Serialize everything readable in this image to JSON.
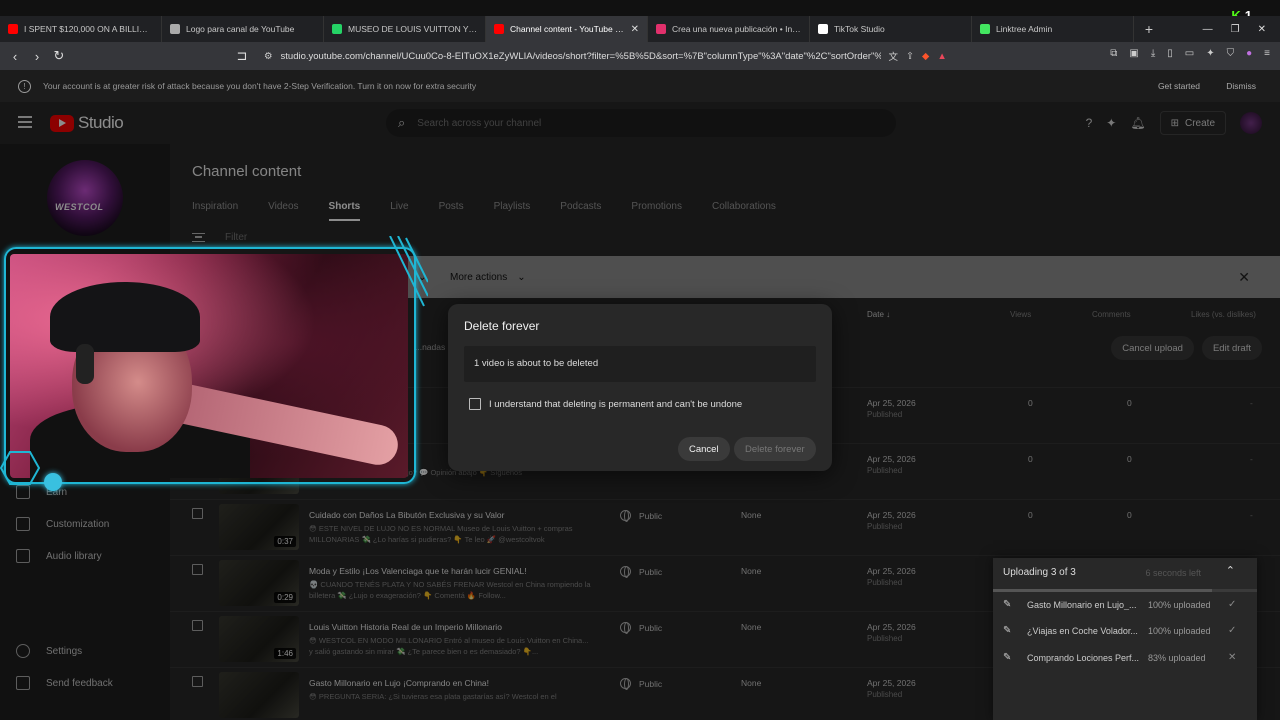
{
  "browser": {
    "tabs": [
      {
        "title": "I SPENT $120,000 ON A BILLIONAIRE",
        "color": "#ff0000"
      },
      {
        "title": "Logo para canal de YouTube",
        "color": "#aaaaaa"
      },
      {
        "title": "MUSEO DE LOUIS VUITTON Y COMP",
        "color": "#25d366"
      },
      {
        "title": "Channel content - YouTube Studio",
        "color": "#ff0000"
      },
      {
        "title": "Crea una nueva publicación • Instagr",
        "color": "#e1306c"
      },
      {
        "title": "TikTok Studio",
        "color": "#ffffff"
      },
      {
        "title": "Linktree Admin",
        "color": "#43e660"
      }
    ],
    "url": "studio.youtube.com/channel/UCuu0Co-8-EITuOX1eZyWLIA/videos/short?filter=%5B%5D&sort=%7B\"columnType\"%3A\"date\"%2C\"sortOrder\"%3...",
    "kick_count": "1"
  },
  "banner": {
    "text": "Your account is at greater risk of attack because you don't have 2-Step Verification. Turn it on now for extra security",
    "get_started": "Get started",
    "dismiss": "Dismiss"
  },
  "header": {
    "logo": "Studio",
    "search_placeholder": "Search across your channel",
    "create": "Create"
  },
  "sidebar": {
    "channel_name": "WESTCOL",
    "items": {
      "earn": "Earn",
      "customization": "Customization",
      "audio_library": "Audio library",
      "settings": "Settings",
      "send_feedback": "Send feedback"
    }
  },
  "main": {
    "title": "Channel content",
    "tabs": [
      "Inspiration",
      "Videos",
      "Shorts",
      "Live",
      "Posts",
      "Playlists",
      "Podcasts",
      "Promotions",
      "Collaborations"
    ],
    "filter_placeholder": "Filter",
    "more_actions": "More actions",
    "columns": {
      "date": "Date ↓",
      "views": "Views",
      "comments": "Comments",
      "likes": "Likes (vs. dislikes)"
    },
    "draft": {
      "text": "...nadas Ex...",
      "cancel_upload": "Cancel upload",
      "edit_draft": "Edit draft"
    },
    "rows": [
      {
        "title": "...ras Exc...",
        "desc": "...TODO W... ...go s acio...",
        "duration": "",
        "visibility": "",
        "restrictions": "",
        "date": "Apr 25, 2026",
        "status": "Published",
        "views": "0",
        "comments": "0",
        "likes": "-"
      },
      {
        "title": "...resa en...",
        "desc": "...AGINAS W... ...e nivel de lujo? 💬 Opinión abajo 👇 Síguenos",
        "duration": "",
        "visibility": "",
        "restrictions": "",
        "date": "Apr 25, 2026",
        "status": "Published",
        "views": "0",
        "comments": "0",
        "likes": "-"
      },
      {
        "title": "Cuidado con Daños La Bibutón Exclusiva y su Valor",
        "desc": "😳 ESTE NIVEL DE LUJO NO ES NORMAL Museo de Louis Vuitton + compras MILLONARIAS 💸 ¿Lo harías si pudieras? 👇 Te leo 🚀 @westcoltvok",
        "duration": "0:37",
        "visibility": "Public",
        "restrictions": "None",
        "date": "Apr 25, 2026",
        "status": "Published",
        "views": "0",
        "comments": "0",
        "likes": "-"
      },
      {
        "title": "Moda y Estilo ¡Los Valenciaga que te harán lucir GENIAL!",
        "desc": "💀 CUANDO TENÉS PLATA Y NO SABÉS FRENAR Westcol en China rompiendo la billetera 💸 ¿Lujo o exageración? 👇 Comentá 🔥 Follow...",
        "duration": "0:29",
        "visibility": "Public",
        "restrictions": "None",
        "date": "Apr 25, 2026",
        "status": "Published",
        "views": "0",
        "comments": "0",
        "likes": "-"
      },
      {
        "title": "Louis Vuitton Historia Real de un Imperio Millonario",
        "desc": "😳 WESTCOL EN MODO MILLONARIO Entró al museo de Louis Vuitton en China... y salió gastando sin mirar 💸 ¿Te parece bien o es demasiado? 👇...",
        "duration": "1:46",
        "visibility": "Public",
        "restrictions": "None",
        "date": "Apr 25, 2026",
        "status": "Published",
        "views": "0",
        "comments": "0",
        "likes": "-"
      },
      {
        "title": "Gasto Millonario en Lujo ¡Comprando en China!",
        "desc": "😳 PREGUNTA SERIA: ¿Si tuvieras esa plata gastarías así? Westcol en el",
        "duration": "",
        "visibility": "Public",
        "restrictions": "None",
        "date": "Apr 25, 2026",
        "status": "Published",
        "views": "0",
        "comments": "0",
        "likes": "-"
      }
    ]
  },
  "dialog": {
    "title": "Delete forever",
    "message": "1 video is about to be deleted",
    "acknowledge": "I understand that deleting is permanent and can't be undone",
    "cancel": "Cancel",
    "delete": "Delete forever"
  },
  "upload_panel": {
    "title": "Uploading 3 of 3",
    "remaining": "6 seconds left",
    "progress_fraction": 0.83,
    "items": [
      {
        "name": "Gasto Millonario en Lujo_...",
        "status": "100% uploaded",
        "icon": "check-icon"
      },
      {
        "name": "¿Viajas en Coche Volador...",
        "status": "100% uploaded",
        "icon": "check-icon"
      },
      {
        "name": "Comprando Lociones Perf...",
        "status": "83% uploaded",
        "icon": "close-icon"
      }
    ]
  }
}
